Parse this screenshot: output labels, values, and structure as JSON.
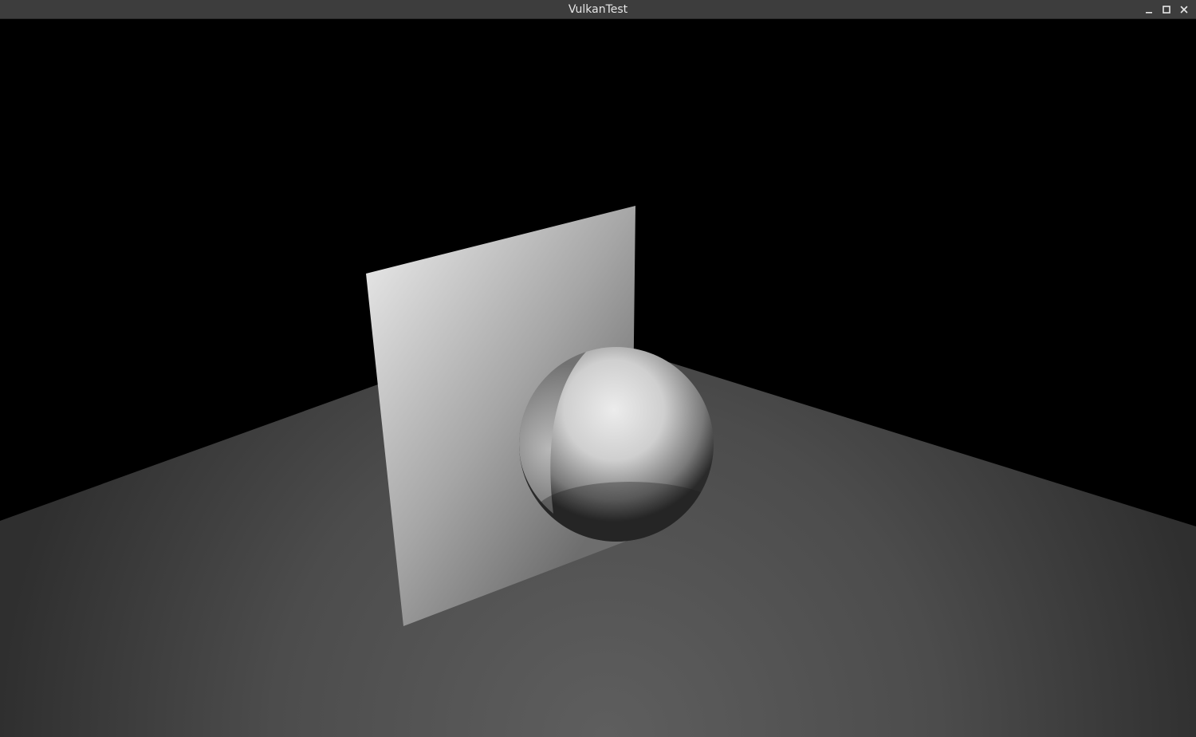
{
  "window": {
    "title": "VulkanTest",
    "controls": {
      "minimize_icon": "minimize-icon",
      "maximize_icon": "maximize-icon",
      "close_icon": "close-icon"
    }
  },
  "scene": {
    "background_color": "#000000",
    "floor_color": "#5a5a5a",
    "panel_color": "#bdbdbd",
    "sphere_color": "#d9d9d9"
  }
}
